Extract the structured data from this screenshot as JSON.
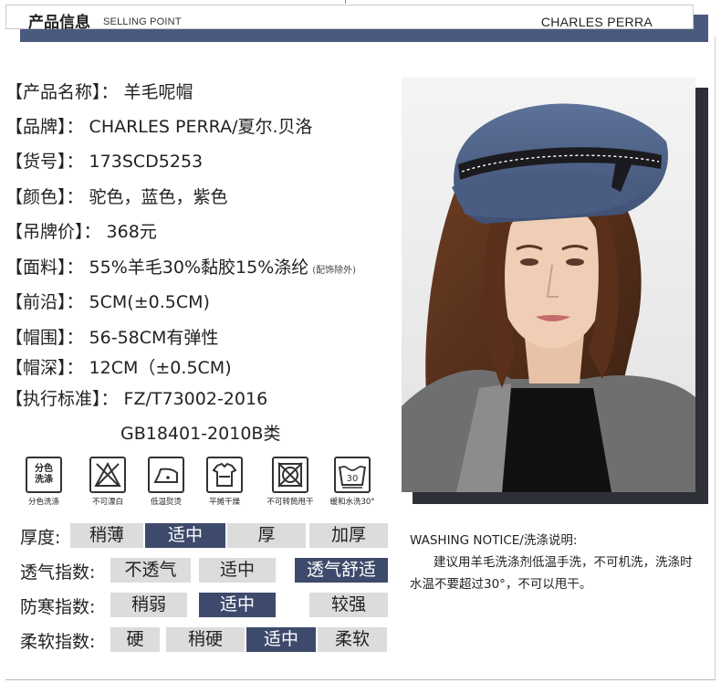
{
  "header": {
    "title": "产品信息",
    "subtitle": "SELLING POINT",
    "brand": "CHARLES PERRA"
  },
  "specs": [
    {
      "label": "【产品名称】",
      "value": "： 羊毛呢帽"
    },
    {
      "label": "【品牌】",
      "value": "： CHARLES PERRA/夏尔.贝洛"
    },
    {
      "label": "【货号】",
      "value": "：  173SCD5253"
    },
    {
      "label": "【颜色】",
      "value": "： 驼色，蓝色，紫色"
    },
    {
      "label": "【吊牌价】",
      "value": "： 368元"
    },
    {
      "label": "【面料】",
      "value": "： 55%羊毛30%黏胶15%涤纶",
      "note": "(配饰除外)"
    },
    {
      "label": "【前沿】",
      "value": "： 5CM(±0.5CM)"
    },
    {
      "label": "【帽围】",
      "value": "： 56-58CM有弹性"
    },
    {
      "label": "【帽深】",
      "value": "： 12CM（±0.5CM)"
    },
    {
      "label": "【执行标准】",
      "value": "： FZ/T73002-2016"
    }
  ],
  "standard_line2": "GB18401-2010B类",
  "care": [
    {
      "icon": "separate-wash-icon",
      "caption": "分色洗涤",
      "inner": "分色\n洗涤"
    },
    {
      "icon": "no-bleach-icon",
      "caption": "不可漂白"
    },
    {
      "icon": "low-iron-icon",
      "caption": "低温熨烫"
    },
    {
      "icon": "flat-dry-icon",
      "caption": "平摊干燥"
    },
    {
      "icon": "no-tumble-dry-icon",
      "caption": "不可转筒甩干"
    },
    {
      "icon": "gentle-wash-30-icon",
      "caption": "缓和水洗30°",
      "inner": "30"
    }
  ],
  "ratings": [
    {
      "label": "厚度:",
      "options": [
        "稍薄",
        "适中",
        "厚",
        "加厚"
      ],
      "selected": 1
    },
    {
      "label": "透气指数:",
      "options": [
        "不透气",
        "适中",
        "透气舒适"
      ],
      "selected": 2
    },
    {
      "label": "防寒指数:",
      "options": [
        "稍弱",
        "适中",
        "较强"
      ],
      "selected": 1
    },
    {
      "label": "柔软指数:",
      "options": [
        "硬",
        "稍硬",
        "适中",
        "柔软"
      ],
      "selected": 2
    }
  ],
  "washing": {
    "title": "WASHING NOTICE/洗涤说明:",
    "body": "建议用羊毛洗涤剂低温手洗，不可机洗，洗涤时水温不要超过30°，不可以甩干。"
  },
  "colors": {
    "accent": "#3d4a6b",
    "header_shadow": "#4a5a7e",
    "cell_bg": "#dcdcdc"
  }
}
